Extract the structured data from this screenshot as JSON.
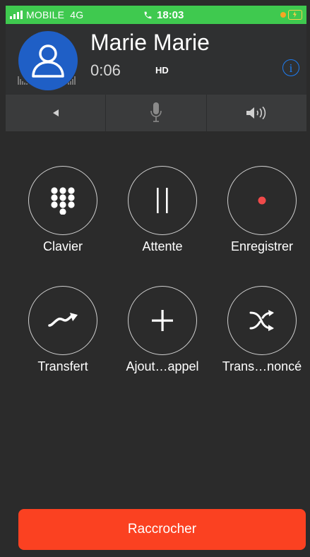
{
  "status": {
    "carrier": "MOBILE",
    "network": "4G",
    "time": "18:03",
    "colors": {
      "bar": "#3fc94f"
    }
  },
  "caller": {
    "name": "Marie Marie",
    "duration": "0:06",
    "quality": "HD",
    "avatar_icon": "person-icon",
    "info_icon": "info-icon",
    "info_glyph": "i"
  },
  "controls": [
    "audio-route-icon",
    "mute-mic-icon",
    "speaker-icon"
  ],
  "actions": [
    {
      "label": "Clavier",
      "icon": "keypad-icon"
    },
    {
      "label": "Attente",
      "icon": "pause-icon"
    },
    {
      "label": "Enregistrer",
      "icon": "record-icon"
    },
    {
      "label": "Transfert",
      "icon": "transfer-icon"
    },
    {
      "label": "Ajout…appel",
      "icon": "add-call-icon"
    },
    {
      "label": "Trans…noncé",
      "icon": "announced-transfer-icon"
    }
  ],
  "hangup": {
    "label": "Raccrocher",
    "color": "#fb4121"
  }
}
